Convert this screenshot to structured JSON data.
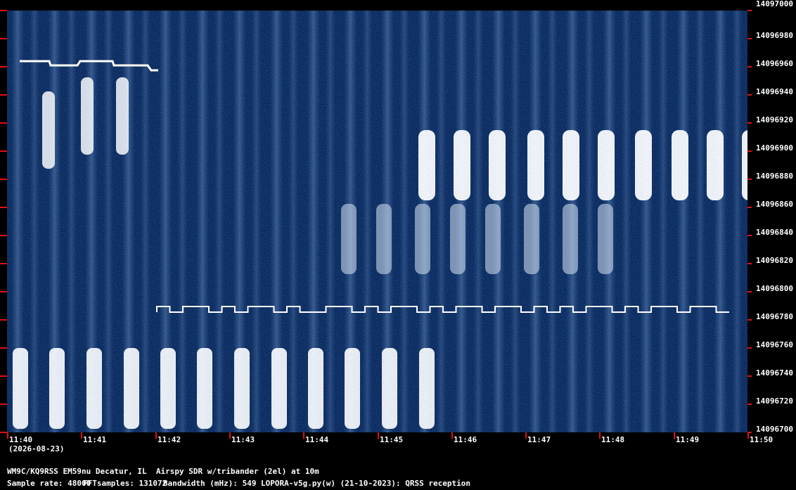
{
  "date_label": "(2026-08-23)",
  "freq_labels": [
    "14097000",
    "14096980",
    "14096960",
    "14096940",
    "14096920",
    "14096900",
    "14096880",
    "14096860",
    "14096840",
    "14096820",
    "14096800",
    "14096780",
    "14096760",
    "14096740",
    "14096720",
    "14096700"
  ],
  "time_labels": [
    "11:40",
    "11:41",
    "11:42",
    "11:43",
    "11:44",
    "11:45",
    "11:46",
    "11:47",
    "11:48",
    "11:49",
    "11:50"
  ],
  "info": {
    "station": "WM9C/KQ9RSS EM59nu Decatur, IL  Airspy SDR w/tribander (2el) at 10m",
    "sample_rate": "Sample rate: 48000",
    "fft_samples": "FFTsamples: 131072",
    "bandwidth": "Bandwidth (mHz): 549",
    "software": "LOPORA-v5g.py(w) (21-10-2023): QRSS reception"
  },
  "colors": {
    "background": "#000000",
    "waterfall_base": "#0a2a5e",
    "signal": "#ffffff",
    "tick": "#e01010"
  }
}
